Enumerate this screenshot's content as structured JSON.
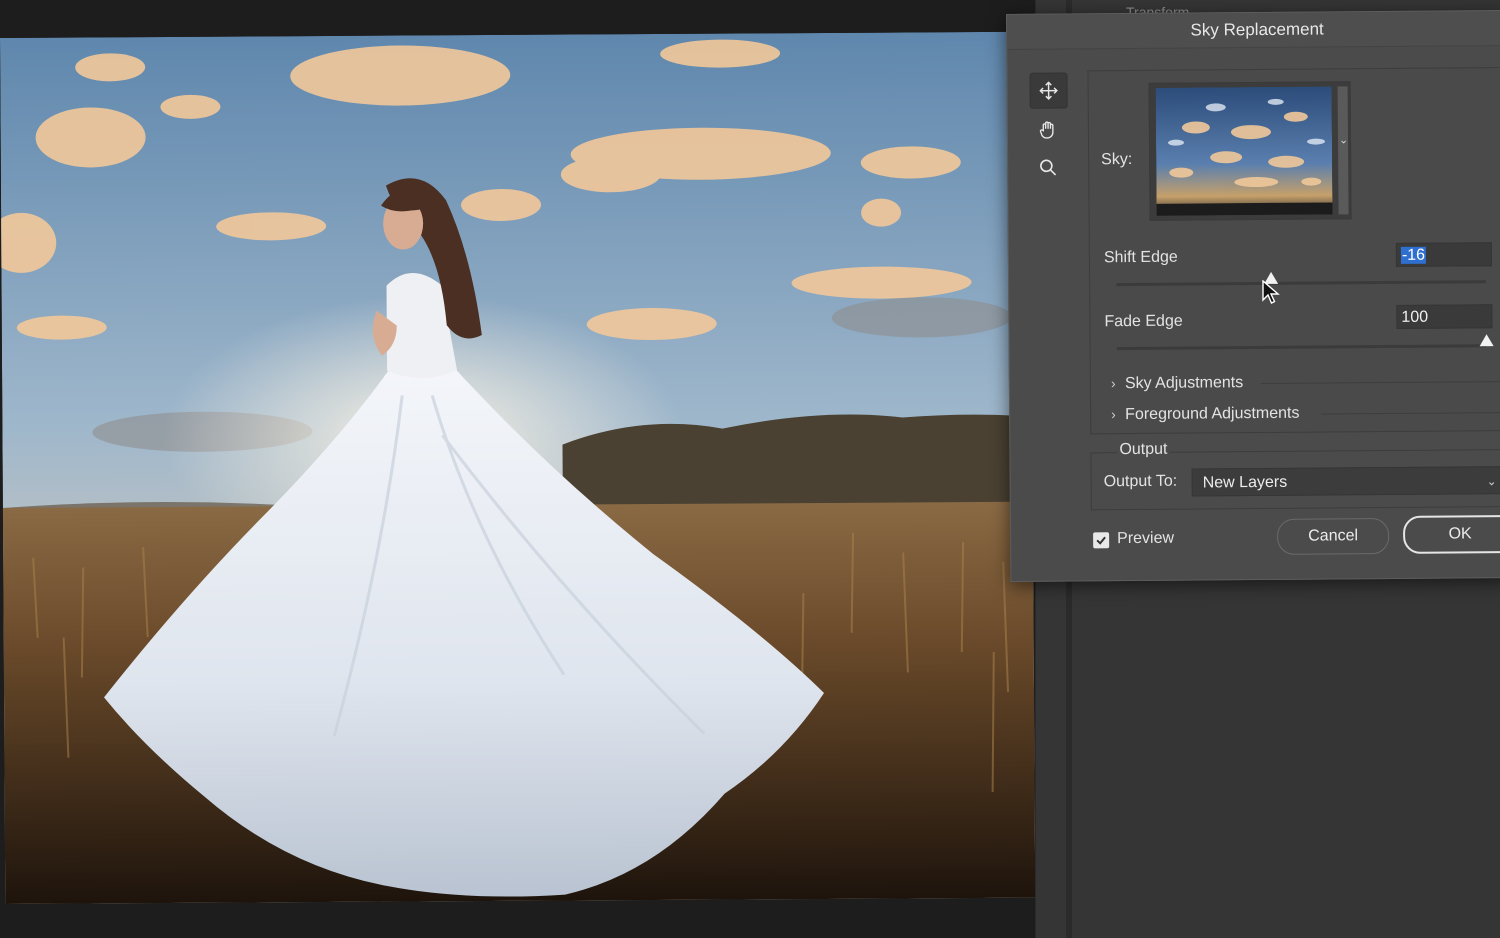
{
  "panel": {
    "heading": "Transform"
  },
  "dialog": {
    "title": "Sky Replacement",
    "tools": [
      {
        "icon": "move-icon",
        "active": true
      },
      {
        "icon": "hand-icon",
        "active": false
      },
      {
        "icon": "zoom-icon",
        "active": false
      }
    ],
    "sky": {
      "label": "Sky:"
    },
    "shift_edge": {
      "label": "Shift Edge",
      "value": "-16",
      "slider_fraction": 0.42
    },
    "fade_edge": {
      "label": "Fade Edge",
      "value": "100",
      "slider_fraction": 1.0
    },
    "sections": [
      {
        "label": "Sky Adjustments"
      },
      {
        "label": "Foreground Adjustments"
      }
    ],
    "output": {
      "heading": "Output",
      "label": "Output To:",
      "selected": "New Layers"
    },
    "preview": {
      "label": "Preview",
      "checked": true
    },
    "buttons": {
      "cancel": "Cancel",
      "ok": "OK"
    }
  },
  "colors": {
    "dialog_bg": "#4b4b4b",
    "highlight": "#2f6fd0",
    "panel_bg": "#353535"
  }
}
